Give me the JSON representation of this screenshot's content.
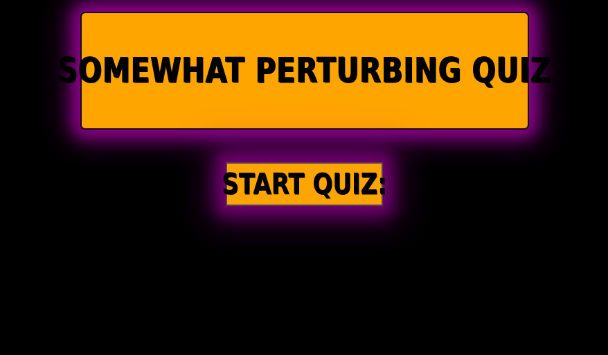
{
  "colors": {
    "background": "#000000",
    "card": "#FFA500",
    "glow": "#8B008B",
    "text": "#000000"
  },
  "header": {
    "title": "SOMEWHAT PERTURBING QUIZ"
  },
  "main": {
    "start_label": "START QUIZ:"
  }
}
